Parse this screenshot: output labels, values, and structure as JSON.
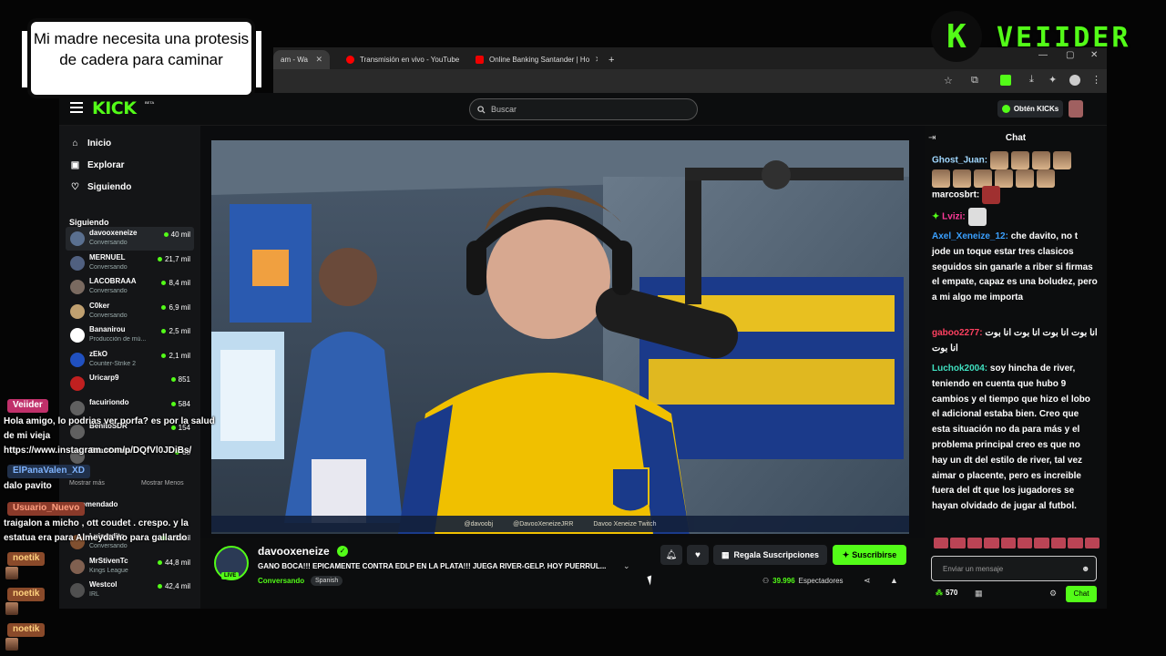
{
  "browser": {
    "tabs": [
      {
        "label": "am - Wa",
        "active": true
      },
      {
        "label": "Transmisión en vivo - YouTube",
        "active": false
      },
      {
        "label": "Online Banking Santander | Ho",
        "active": false
      }
    ],
    "new_tab": "+"
  },
  "kick": {
    "logo": "KICK",
    "beta": "BETA",
    "search_placeholder": "Buscar",
    "kicks_button": "Obtén KICKs"
  },
  "sidebar": {
    "nav": [
      {
        "label": "Inicio",
        "icon": "home-icon"
      },
      {
        "label": "Explorar",
        "icon": "browse-icon"
      },
      {
        "label": "Siguiendo",
        "icon": "heart-icon"
      }
    ],
    "following_heading": "Siguiendo",
    "channels": [
      {
        "name": "davooxeneize",
        "category": "Conversando",
        "viewers": "40 mil",
        "color": "#5a7090"
      },
      {
        "name": "MERNUEL",
        "category": "Conversando",
        "viewers": "21,7 mil",
        "color": "#506080"
      },
      {
        "name": "LACOBRAAA",
        "category": "Conversando",
        "viewers": "8,4 mil",
        "color": "#7a6a60"
      },
      {
        "name": "C0ker",
        "category": "Conversando",
        "viewers": "6,9 mil",
        "color": "#c0a070"
      },
      {
        "name": "Bananirou",
        "category": "Producción de mú...",
        "viewers": "2,5 mil",
        "color": "#ffffff"
      },
      {
        "name": "zEkO",
        "category": "Counter-Strike 2",
        "viewers": "2,1 mil",
        "color": "#2050c0"
      },
      {
        "name": "Uricarp9",
        "category": "",
        "viewers": "851",
        "color": "#c02020"
      },
      {
        "name": "facuiriondo",
        "category": "",
        "viewers": "584",
        "color": "#606060"
      },
      {
        "name": "BenitoSDR",
        "category": "",
        "viewers": "154",
        "color": "#606060"
      },
      {
        "name": "BrianCelora",
        "category": "",
        "viewers": "88",
        "color": "#606060"
      }
    ],
    "show_more": "Mostrar más",
    "show_less": "Mostrar Menos",
    "recommended_heading": "omendado",
    "recommended": [
      {
        "name": "Luisardito",
        "category": "Conversando",
        "viewers": "1,9 mil",
        "color": "#805030"
      },
      {
        "name": "MrStivenTc",
        "category": "Kings League",
        "viewers": "44,8 mil",
        "color": "#806050"
      },
      {
        "name": "Westcol",
        "category": "IRL",
        "viewers": "42,4 mil",
        "color": "#505050"
      }
    ]
  },
  "video_overlay": [
    "@davoobj",
    "@DavooXeneizeJRR",
    "Davoo Xeneize Twitch"
  ],
  "stream": {
    "streamer": "davooxeneize",
    "live": "LIVE",
    "title": "GANO BOCA!!! EPICAMENTE CONTRA EDLP EN LA PLATA!!! JUEGA RIVER-GELP. HOY PUERRUL...",
    "category": "Conversando",
    "language": "Spanish",
    "gift_button": "Regala Suscripciones",
    "subscribe_button": "Suscribirse",
    "viewer_count": "39.996",
    "viewer_label": "Espectadores"
  },
  "chat": {
    "header": "Chat",
    "messages": [
      {
        "user": "Ghost_Juan:",
        "color": "#a0d8ff",
        "text": "",
        "emotes": 6
      },
      {
        "user": "marcosbrt:",
        "color": "#ffffff",
        "text": "",
        "emotes": 1
      },
      {
        "user": "Lvizi:",
        "color": "#ff3a9a",
        "text": "",
        "emotes": 1
      },
      {
        "user": "Axel_Xeneize_12:",
        "color": "#3aa0ff",
        "text": "che davito, no t jode un toque estar tres clasicos seguidos sin ganarle a riber si firmas el empate, capaz es una boludez, pero a mi algo me importa",
        "emotes": 0
      },
      {
        "user": "gaboo2277:",
        "color": "#ff4060",
        "text": "انا بوت انا بوت انا بوت انا بوت انا بوت",
        "emotes": 0
      },
      {
        "user": "Luchok2004:",
        "color": "#40e0c0",
        "text": "soy hincha de river, teniendo en cuenta que hubo 9 cambios y el tiempo que hizo el lobo el adicional estaba bien. Creo que esta situación no da para más y el problema principal creo es que no hay un dt del estilo de river, tal vez aimar o placente, pero es increible fuera del dt que los jugadores se hayan olvidado de jugar al futbol.",
        "emotes": 0
      }
    ],
    "input_placeholder": "Enviar un mensaje",
    "points": "570",
    "send_button": "Chat"
  },
  "overlay": {
    "caption": "Mi madre necesita una protesis de cadera para caminar",
    "brand": "VEIIDER",
    "brand_logo": "K",
    "chat": [
      {
        "user": "Veiider",
        "bg": "#c0306a",
        "text": "Hola amigo, lo podrias ver porfa? es por la salud de mi vieja https://www.instagram.com/p/DQfVl0JDiBs/"
      },
      {
        "user": "ElPanaValen_XD",
        "bg": "#20304a",
        "text": "dalo pavito"
      },
      {
        "user": "Usuario_Nuevo",
        "bg": "#8a3a2a",
        "text": "traigalon a micho , ott coudet . crespo. y la estatua era para Almeyda no para gallardo"
      },
      {
        "user": "noetik",
        "bg": "#8a4a2a",
        "text": ""
      },
      {
        "user": "noetik",
        "bg": "#8a4a2a",
        "text": ""
      },
      {
        "user": "noetik",
        "bg": "#8a4a2a",
        "text": ""
      }
    ]
  }
}
